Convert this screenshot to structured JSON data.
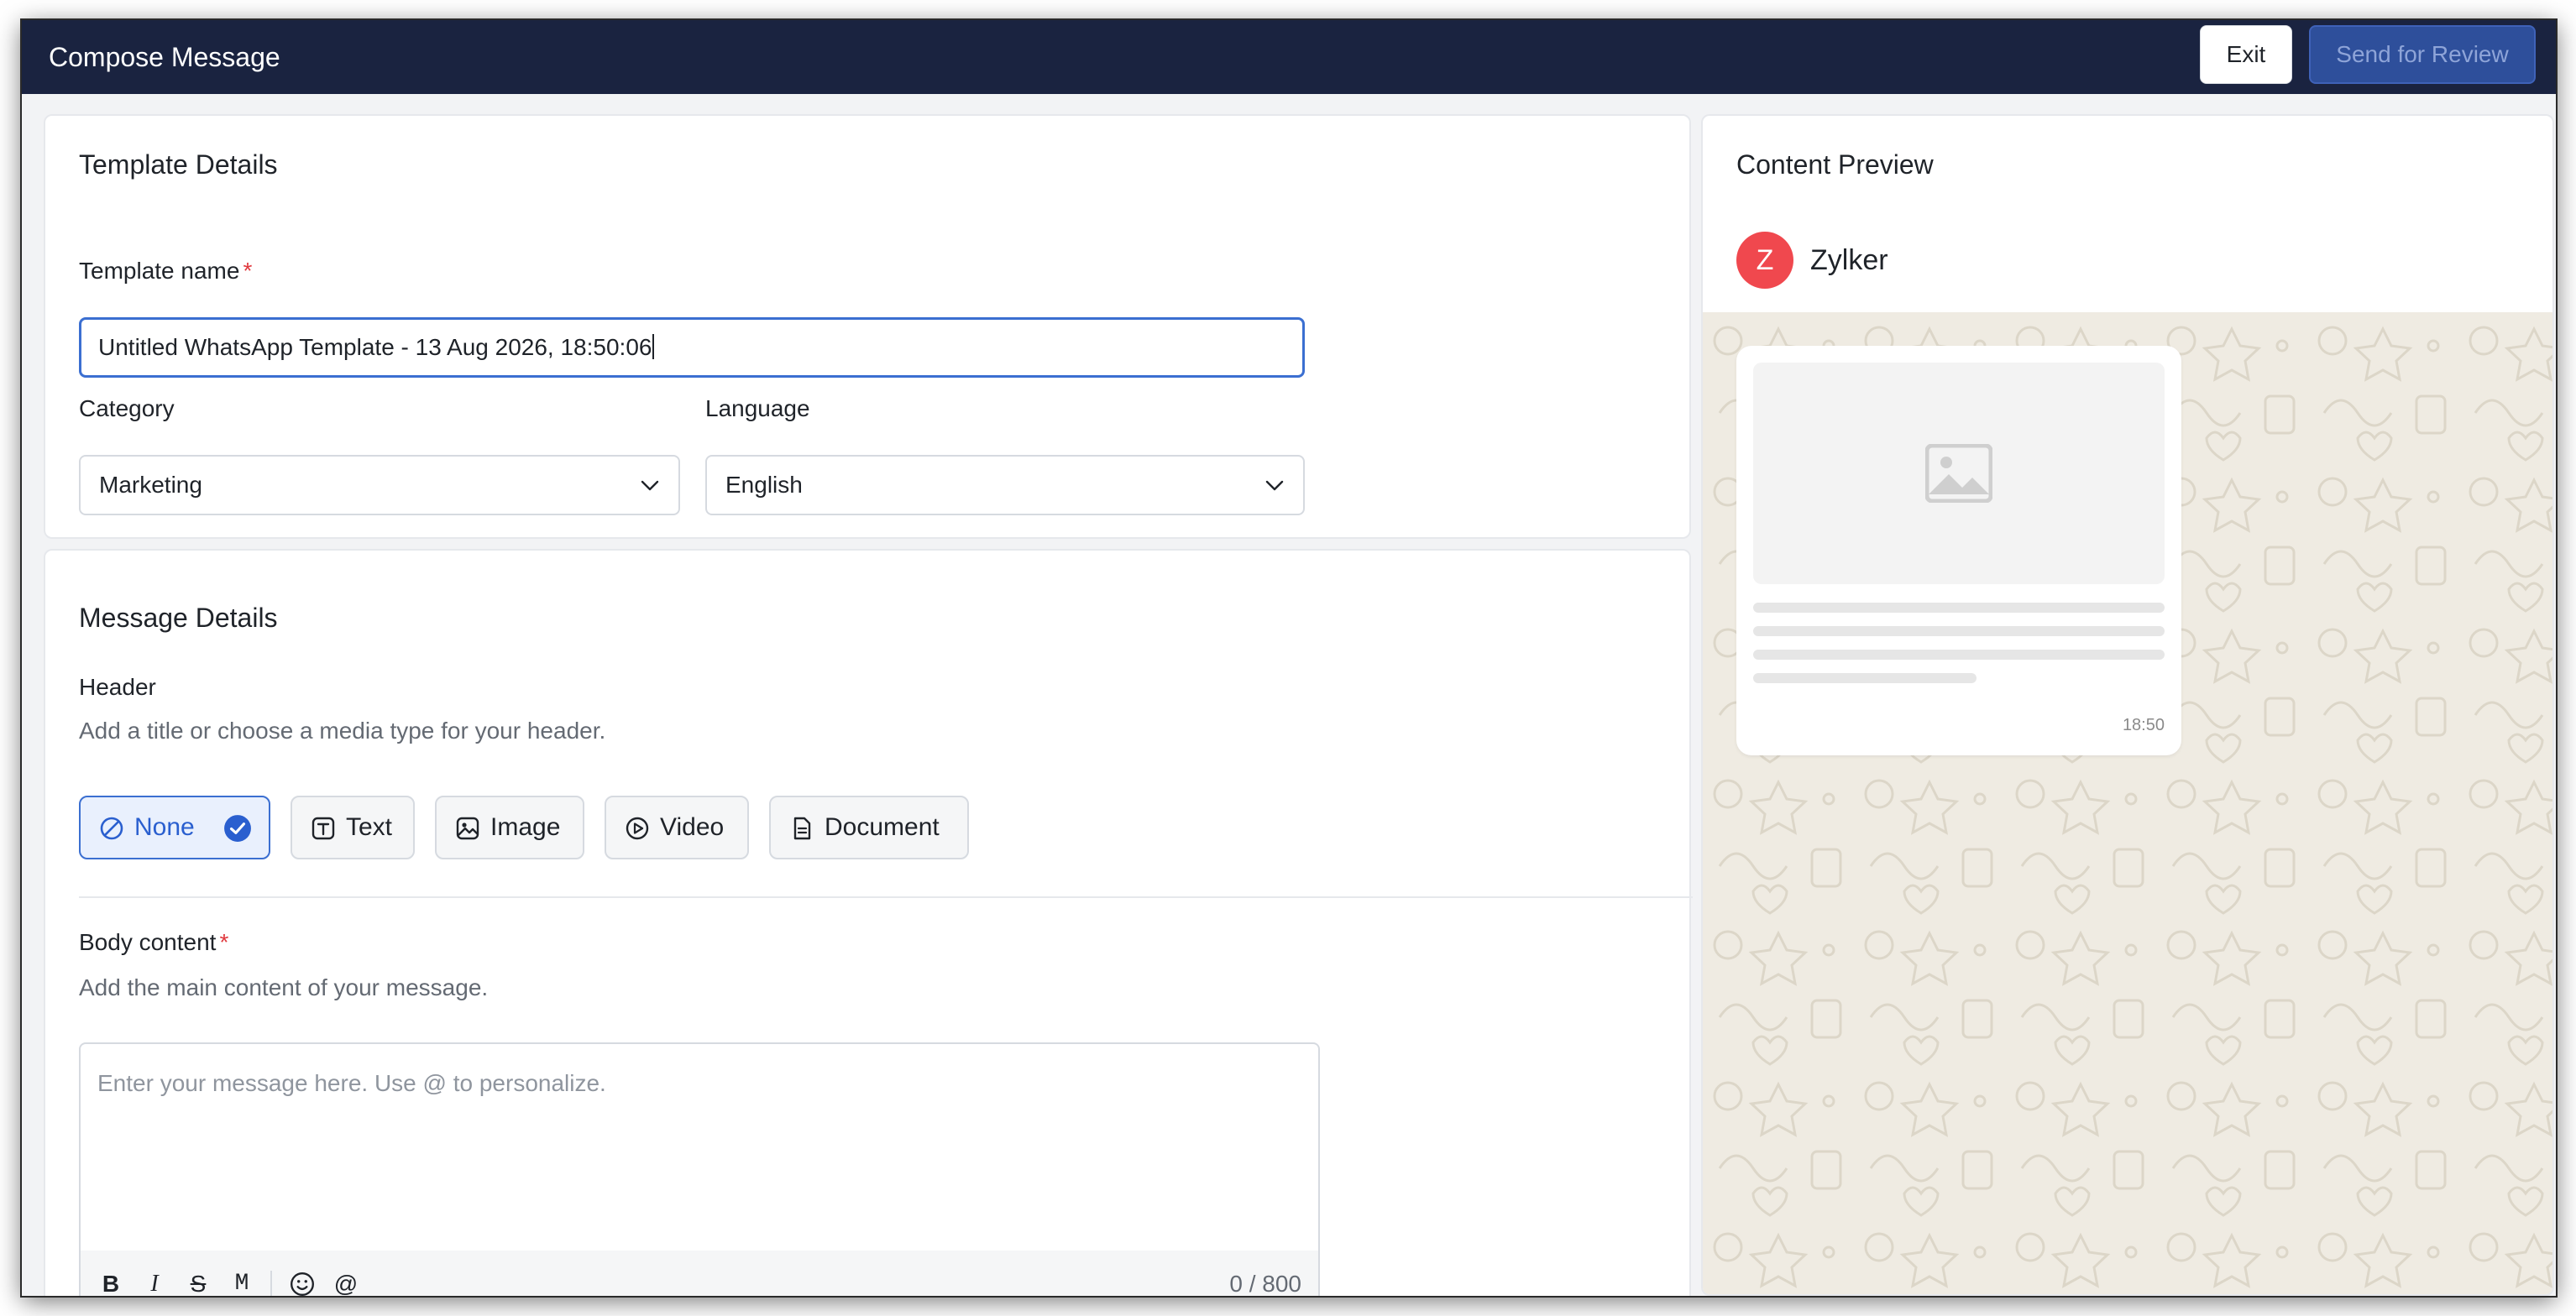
{
  "app": {
    "title": "Compose Message",
    "exit_label": "Exit",
    "send_label": "Send for Review"
  },
  "template_details": {
    "title": "Template Details",
    "name_label": "Template name",
    "required_mark": "*",
    "name_value": "Untitled WhatsApp Template - 13 Aug 2026, 18:50:06",
    "category_label": "Category",
    "category_value": "Marketing",
    "language_label": "Language",
    "language_value": "English"
  },
  "message_details": {
    "title": "Message Details",
    "header_label": "Header",
    "header_help": "Add a title or choose a media type for your header.",
    "header_options": [
      {
        "label": "None",
        "icon": "ban-icon",
        "selected": true
      },
      {
        "label": "Text",
        "icon": "text-icon",
        "selected": false
      },
      {
        "label": "Image",
        "icon": "image-icon",
        "selected": false
      },
      {
        "label": "Video",
        "icon": "play-icon",
        "selected": false
      },
      {
        "label": "Document",
        "icon": "document-icon",
        "selected": false
      }
    ],
    "body_label": "Body content",
    "body_help": "Add the main content of your message.",
    "body_placeholder": "Enter your message here. Use @ to personalize.",
    "toolbar": {
      "bold": "B",
      "italic": "I",
      "strike": "S",
      "mono": "M",
      "emoji_icon": "emoji-icon",
      "mention": "@"
    },
    "char_counter": "0 / 800"
  },
  "content_preview": {
    "title": "Content Preview",
    "avatar_letter": "Z",
    "brand_name": "Zylker",
    "message_time": "18:50"
  },
  "colors": {
    "topbar": "#1a2340",
    "send_button": "#2e4f9b",
    "accent": "#3b6fd1",
    "avatar": "#f0484e",
    "chat_background": "#efebe2"
  }
}
